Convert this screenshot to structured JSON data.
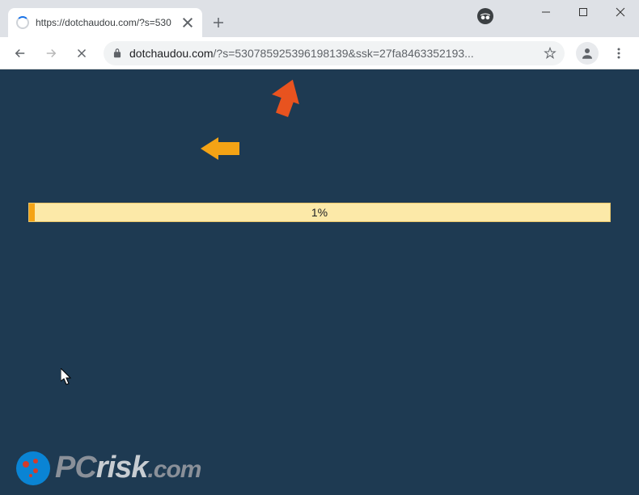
{
  "window": {
    "title": "https://dotchaudou.com/?s=530…"
  },
  "tab": {
    "title": "https://dotchaudou.com/?s=530"
  },
  "address_bar": {
    "domain": "dotchaudou.com",
    "path": "/?s=530785925396198139&ssk=27fa8463352193..."
  },
  "page": {
    "progress_percent": "1%",
    "progress_value": 1
  },
  "watermark": {
    "part1": "PC",
    "part2": "risk",
    "part3": ".com"
  }
}
